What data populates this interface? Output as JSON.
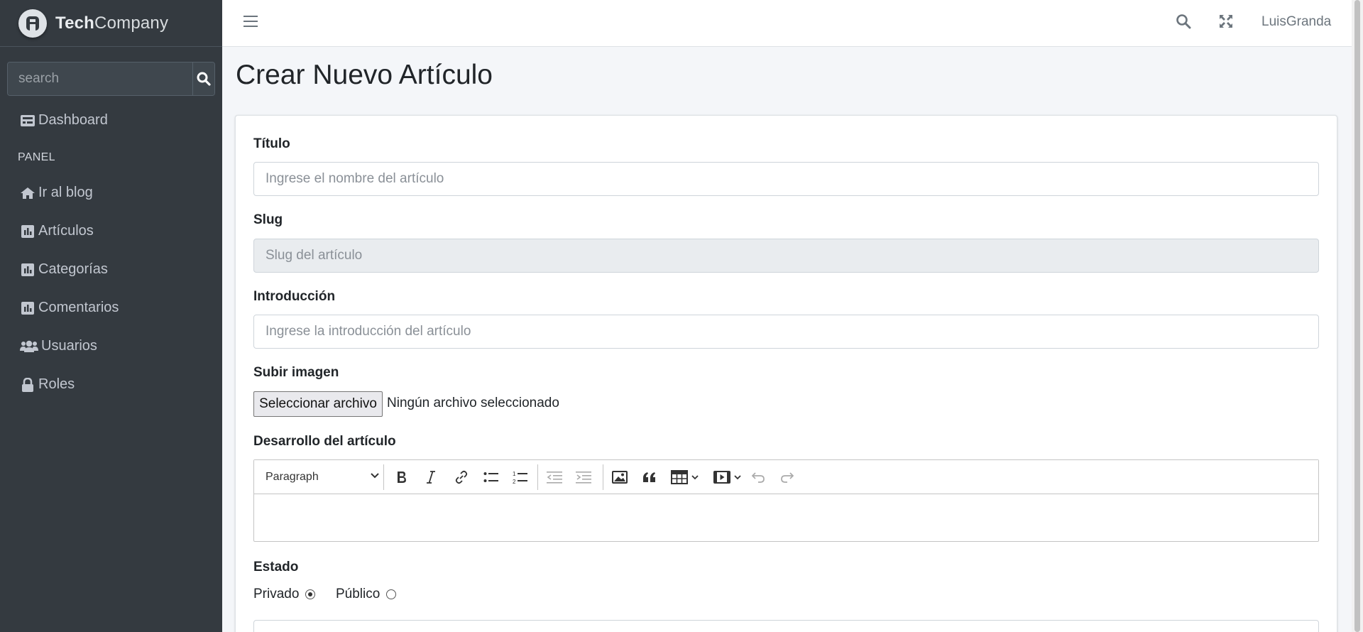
{
  "brand": {
    "name_bold": "Tech",
    "name_light": "Company",
    "logo_letter": "A"
  },
  "sidebar": {
    "search_placeholder": "search",
    "dashboard_label": "Dashboard",
    "panel_header": "PANEL",
    "items": [
      {
        "label": "Ir al blog",
        "icon": "home-icon"
      },
      {
        "label": "Artículos",
        "icon": "chart-bar-icon"
      },
      {
        "label": "Categorías",
        "icon": "chart-bar-icon"
      },
      {
        "label": "Comentarios",
        "icon": "chart-bar-icon"
      },
      {
        "label": "Usuarios",
        "icon": "users-icon"
      },
      {
        "label": "Roles",
        "icon": "lock-icon"
      }
    ]
  },
  "topbar": {
    "user_name": "LuisGranda"
  },
  "page": {
    "title": "Crear Nuevo Artículo"
  },
  "form": {
    "titulo": {
      "label": "Título",
      "placeholder": "Ingrese el nombre del artículo",
      "value": ""
    },
    "slug": {
      "label": "Slug",
      "placeholder": "Slug del artículo",
      "value": ""
    },
    "introduccion": {
      "label": "Introducción",
      "placeholder": "Ingrese la introducción del artículo",
      "value": ""
    },
    "imagen": {
      "label": "Subir imagen",
      "button_label": "Seleccionar archivo",
      "status": "Ningún archivo seleccionado"
    },
    "desarrollo": {
      "label": "Desarrollo del artículo",
      "format": "Paragraph"
    },
    "estado": {
      "label": "Estado",
      "options": [
        {
          "label": "Privado",
          "checked": true
        },
        {
          "label": "Público",
          "checked": false
        }
      ]
    }
  }
}
